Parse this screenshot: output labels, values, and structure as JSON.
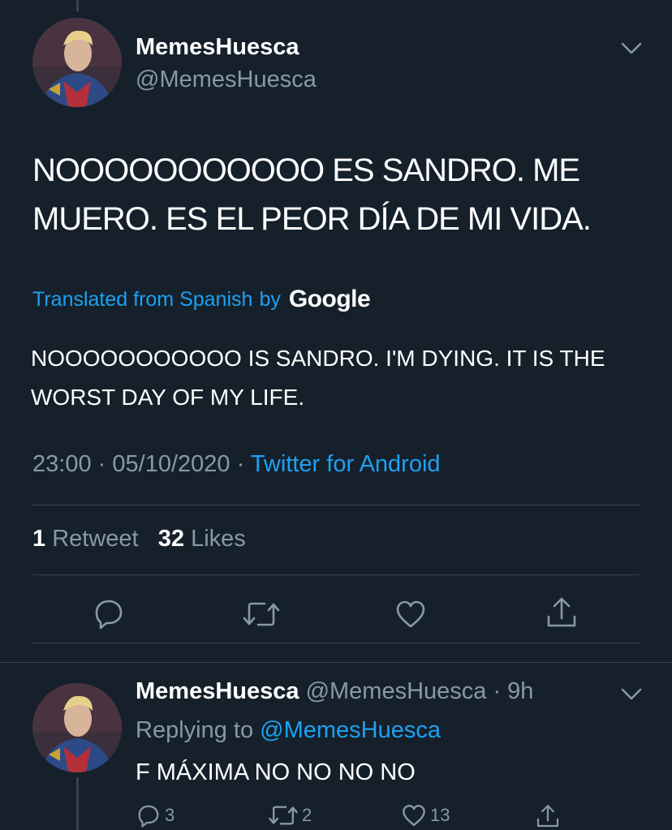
{
  "main_tweet": {
    "author_name": "MemesHuesca",
    "author_handle": "@MemesHuesca",
    "text": "NOOOOOOOOOOO ES SANDRO. ME MUERO. ES EL PEOR DÍA DE MI VIDA.",
    "translated_label": "Translated from Spanish",
    "translated_by": "by",
    "translator": "Google",
    "translation": "NOOOOOOOOOOO IS SANDRO. I'M DYING. IT IS THE WORST DAY OF MY LIFE.",
    "time": "23:00",
    "date": "05/10/2020",
    "separator": "·",
    "source": "Twitter for Android",
    "retweet_count": "1",
    "retweet_label": "Retweet",
    "like_count": "32",
    "like_label": "Likes"
  },
  "reply_tweet": {
    "author_name": "MemesHuesca",
    "author_handle": "@MemesHuesca",
    "age": "· 9h",
    "replying_to_label": "Replying to",
    "replying_to": "@MemesHuesca",
    "text": "F MÁXIMA NO NO NO NO",
    "reply_count": "3",
    "retweet_count": "2",
    "like_count": "13"
  },
  "icons": [
    "chevron-down-icon",
    "reply-icon",
    "retweet-icon",
    "like-icon",
    "share-icon"
  ],
  "colors": {
    "background": "#15202b",
    "secondary_text": "#8899a6",
    "accent": "#1da1f2",
    "divider": "#38444d"
  }
}
